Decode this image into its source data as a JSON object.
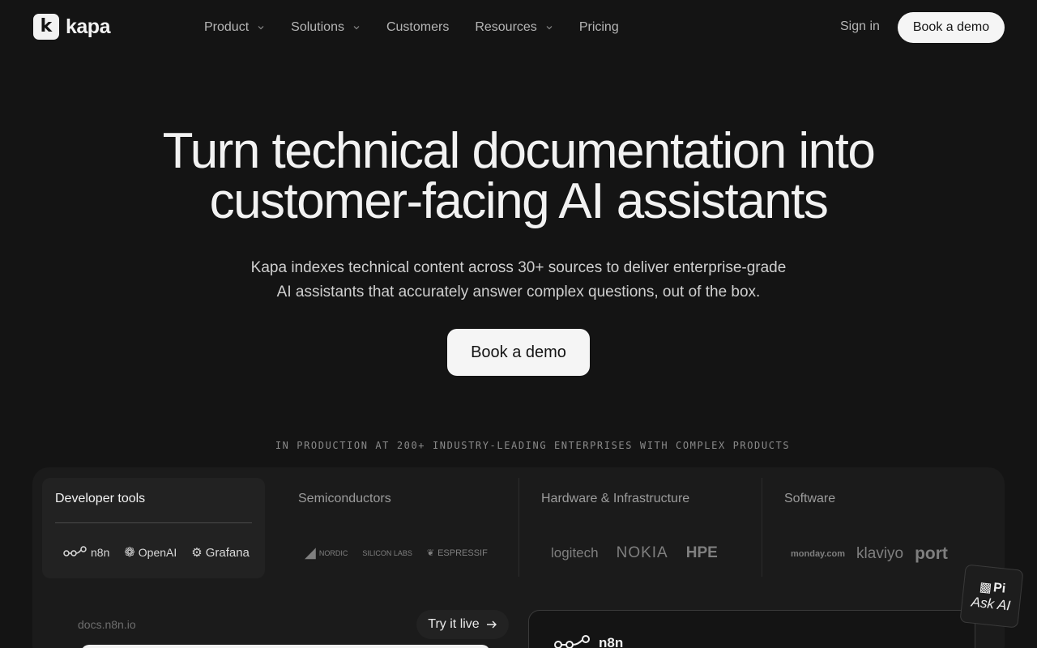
{
  "nav": {
    "logo_text": "kapa",
    "items": [
      {
        "label": "Product",
        "dropdown": true
      },
      {
        "label": "Solutions",
        "dropdown": true
      },
      {
        "label": "Customers",
        "dropdown": false
      },
      {
        "label": "Resources",
        "dropdown": true
      },
      {
        "label": "Pricing",
        "dropdown": false
      }
    ],
    "sign_in": "Sign in",
    "book_demo": "Book a demo"
  },
  "hero": {
    "title_line1": "Turn technical documentation into",
    "title_line2": "customer-facing AI assistants",
    "subtitle_line1": "Kapa indexes technical content across 30+ sources to deliver enterprise-grade",
    "subtitle_line2": "AI assistants that accurately answer complex questions, out of the box.",
    "cta": "Book a demo"
  },
  "customers": {
    "eyebrow": "IN PRODUCTION AT 200+ INDUSTRY-LEADING ENTERPRISES WITH COMPLEX PRODUCTS",
    "categories": [
      {
        "label": "Developer tools",
        "active": true,
        "logos": [
          "n8n",
          "OpenAI",
          "Grafana"
        ]
      },
      {
        "label": "Semiconductors",
        "active": false,
        "logos": [
          "NORDIC",
          "SILICON LABS",
          "ESPRESSIF"
        ]
      },
      {
        "label": "Hardware & Infrastructure",
        "active": false,
        "logos": [
          "logitech",
          "NOKIA",
          "HPE"
        ]
      },
      {
        "label": "Software",
        "active": false,
        "logos": [
          "monday.com",
          "klaviyo",
          "port"
        ]
      }
    ]
  },
  "demo": {
    "docs_url": "docs.n8n.io",
    "try_live": "Try it live",
    "preview_brand": "n8n"
  },
  "ask_ai": {
    "label": "Ask AI",
    "image_alt": "Pi"
  },
  "colors": {
    "background": "#141414",
    "panel": "#1b1b1b",
    "button": "#f5f5f5"
  }
}
